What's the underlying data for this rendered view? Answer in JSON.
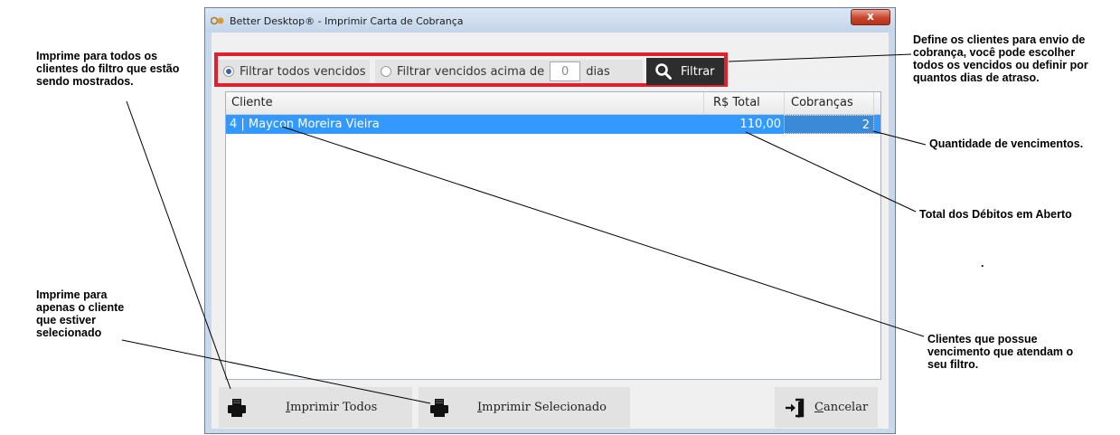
{
  "window": {
    "title": "Better Desktop® - Imprimir Carta de Cobrança",
    "close_symbol": "x"
  },
  "filter": {
    "option_all_label": "Filtrar todos vencidos",
    "option_all_selected": true,
    "option_days_label": "Filtrar vencidos acima de",
    "days_value": "0",
    "days_suffix": "dias",
    "filter_button_label": "Filtrar",
    "filter_button_icon": "search-icon"
  },
  "grid": {
    "columns": [
      "Cliente",
      "R$ Total",
      "Cobranças"
    ],
    "rows": [
      {
        "cliente": "4 | Maycon Moreira Vieira",
        "total": "110,00",
        "cobrancas": "2"
      }
    ]
  },
  "buttons": {
    "print_all_mnemonic": "I",
    "print_all_rest": "mprimir Todos",
    "print_selected_mnemonic": "I",
    "print_selected_rest": "mprimir Selecionado",
    "cancel_mnemonic": "C",
    "cancel_rest": "ancelar",
    "print_icon": "printer-icon",
    "cancel_icon": "exit-door-icon"
  },
  "annotations": {
    "print_all_note": [
      "Imprime para todos os",
      "clientes do filtro que estão",
      "sendo mostrados."
    ],
    "print_selected_note": [
      "Imprime para",
      "apenas o cliente",
      "que estiver",
      "selecionado"
    ],
    "filter_note": [
      "Define os clientes para envio de",
      "cobrança, você pode escolher",
      "todos os vencidos ou definir por",
      "quantos dias de atraso."
    ],
    "count_note": "Quantidade de vencimentos.",
    "total_note": "Total dos Débitos em Aberto",
    "clients_note": [
      "Clientes que possue",
      "vencimento que atendam o",
      "seu filtro."
    ],
    "stray_dot": "."
  },
  "colors": {
    "highlight_border": "#e0202c",
    "selection": "#3399ff",
    "filter_button_bg": "#2d2d2d"
  }
}
